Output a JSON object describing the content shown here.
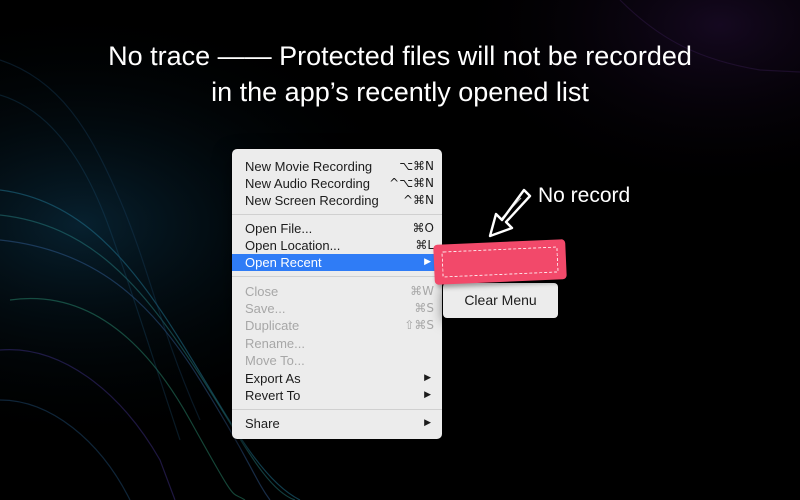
{
  "headline": {
    "line1": "No trace —— Protected files will not be recorded",
    "line2": "in the app’s recently opened list"
  },
  "menu": {
    "items": [
      {
        "label": "New Movie Recording",
        "shortcut": "⌥⌘N"
      },
      {
        "label": "New Audio Recording",
        "shortcut": "^⌥⌘N"
      },
      {
        "label": "New Screen Recording",
        "shortcut": "^⌘N"
      },
      {
        "label": "Open File...",
        "shortcut": "⌘O"
      },
      {
        "label": "Open Location...",
        "shortcut": "⌘L"
      },
      {
        "label": "Open Recent",
        "shortcut": "▶",
        "selected": true
      },
      {
        "label": "Close",
        "shortcut": "⌘W",
        "disabled": true
      },
      {
        "label": "Save...",
        "shortcut": "⌘S",
        "disabled": true
      },
      {
        "label": "Duplicate",
        "shortcut": "⇧⌘S",
        "disabled": true
      },
      {
        "label": "Rename...",
        "shortcut": "",
        "disabled": true
      },
      {
        "label": "Move To...",
        "shortcut": "",
        "disabled": true
      },
      {
        "label": "Export As",
        "shortcut": "▶"
      },
      {
        "label": "Revert To",
        "shortcut": "▶"
      },
      {
        "label": "Share",
        "shortcut": "▶"
      }
    ]
  },
  "submenu": {
    "clear_label": "Clear Menu"
  },
  "annotation": {
    "text": "No record"
  },
  "colors": {
    "accent": "#2f7cf6",
    "tag": "#f2496a",
    "background": "#000000"
  }
}
